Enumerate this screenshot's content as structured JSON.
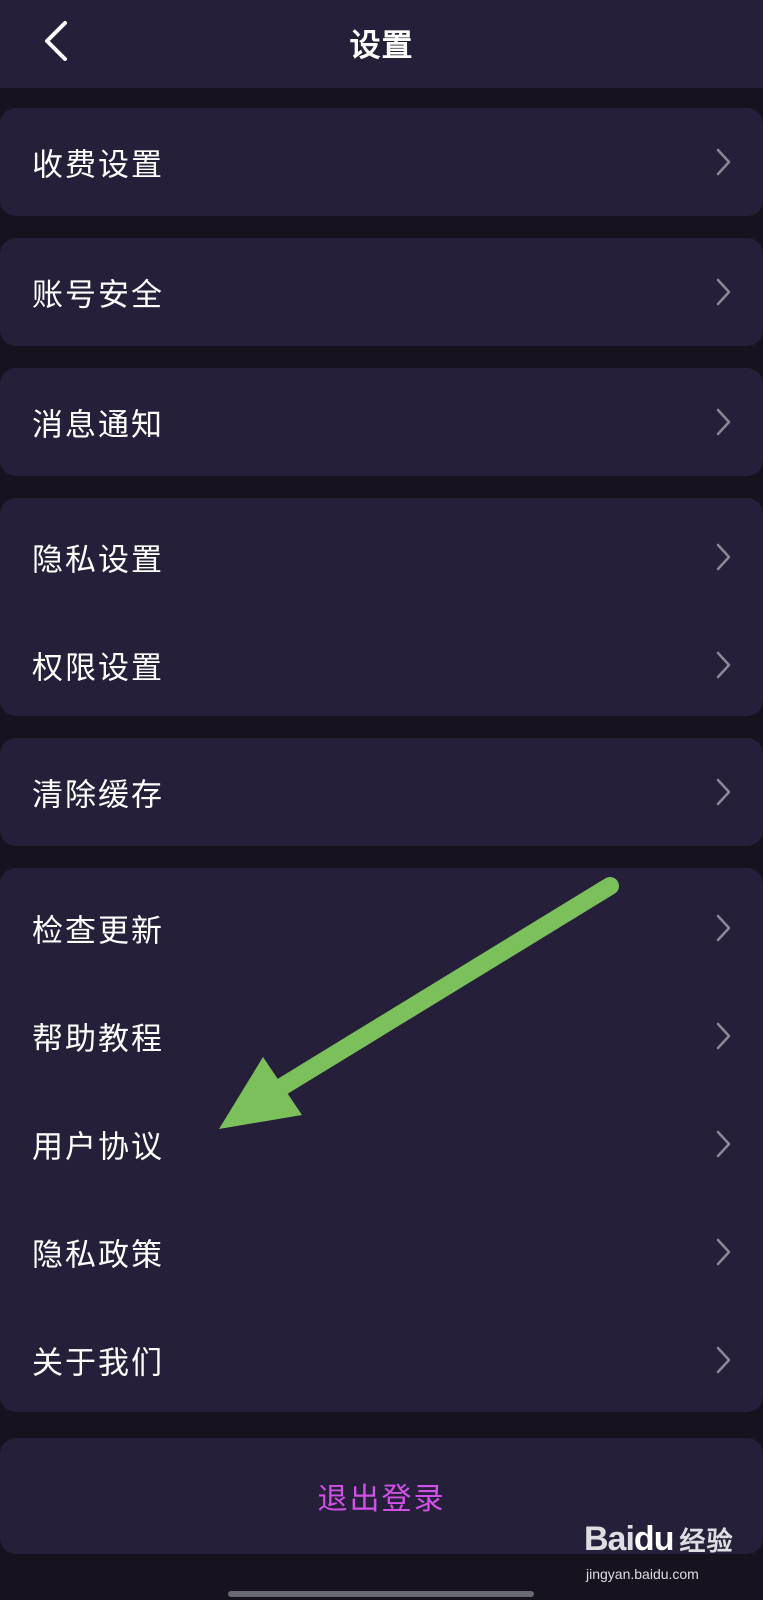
{
  "header": {
    "title": "设置"
  },
  "menu": {
    "fee_settings": "收费设置",
    "account_security": "账号安全",
    "notifications": "消息通知",
    "privacy_settings": "隐私设置",
    "permission_settings": "权限设置",
    "clear_cache": "清除缓存",
    "check_update": "检查更新",
    "help_tutorial": "帮助教程",
    "user_agreement": "用户协议",
    "privacy_policy": "隐私政策",
    "about_us": "关于我们"
  },
  "logout": {
    "label": "退出登录"
  },
  "annotation": {
    "color": "#7cc05c"
  },
  "watermark": {
    "brand": "Bai",
    "brand_du": "du",
    "brand_cn": "经验",
    "url": "jingyan.baidu.com"
  },
  "colors": {
    "background": "#16131f",
    "card": "#251f39",
    "accent": "#d050e8"
  }
}
